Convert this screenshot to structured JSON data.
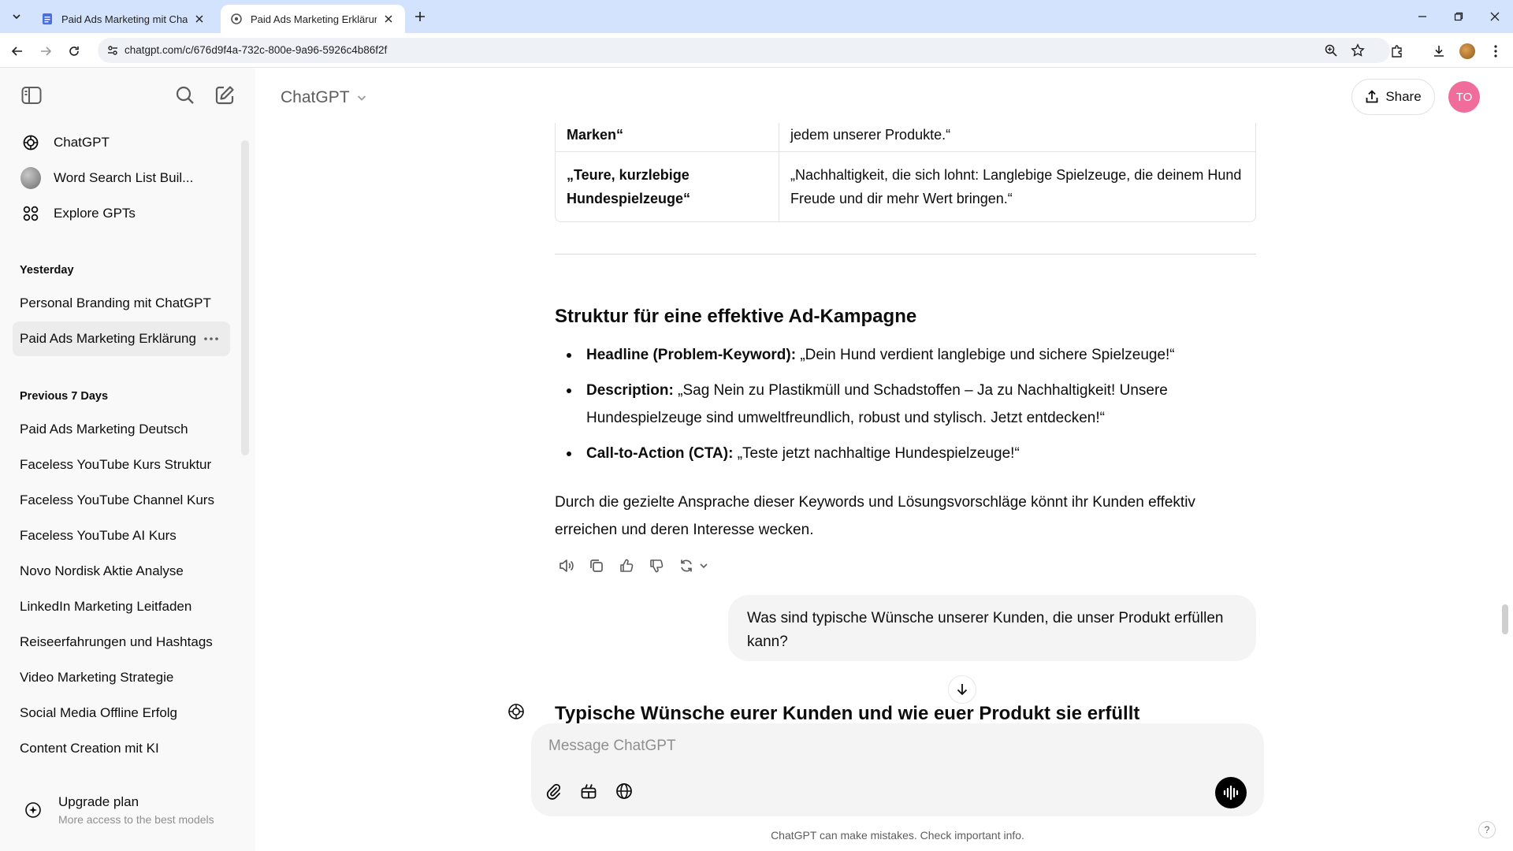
{
  "browser": {
    "tabs": [
      {
        "title": "Paid Ads Marketing mit ChatGPT",
        "active": false
      },
      {
        "title": "Paid Ads Marketing Erklärung",
        "active": true
      }
    ],
    "url": "chatgpt.com/c/676d9f4a-732c-800e-9a96-5926c4b86f2f"
  },
  "sidebar": {
    "nav": [
      {
        "label": "ChatGPT",
        "icon": "openai-logo-icon"
      },
      {
        "label": "Word Search List Buil...",
        "icon": "gpt-avatar"
      },
      {
        "label": "Explore GPTs",
        "icon": "grid-icon"
      }
    ],
    "sections": [
      {
        "title": "Yesterday",
        "items": [
          "Personal Branding mit ChatGPT",
          "Paid Ads Marketing Erklärung"
        ]
      },
      {
        "title": "Previous 7 Days",
        "items": [
          "Paid Ads Marketing Deutsch",
          "Faceless YouTube Kurs Struktur",
          "Faceless YouTube Channel Kurs",
          "Faceless YouTube AI Kurs",
          "Novo Nordisk Aktie Analyse",
          "LinkedIn Marketing Leitfaden",
          "Reiseerfahrungen und Hashtags",
          "Video Marketing Strategie",
          "Social Media Offline Erfolg",
          "Content Creation mit KI"
        ]
      }
    ],
    "upgrade": {
      "title": "Upgrade plan",
      "subtitle": "More access to the best models"
    }
  },
  "header": {
    "model": "ChatGPT",
    "share_label": "Share",
    "user_initials": "TO"
  },
  "table": {
    "rows": [
      {
        "problem": "Marken“",
        "solution": "jedem unserer Produkte.“"
      },
      {
        "problem": "„Teure, kurzlebige Hundespielzeuge“",
        "solution": "„Nachhaltigkeit, die sich lohnt: Langlebige Spielzeuge, die deinem Hund Freude und dir mehr Wert bringen.“"
      }
    ]
  },
  "answer": {
    "heading": "Struktur für eine effektive Ad-Kampagne",
    "bullets": [
      {
        "label": "Headline (Problem-Keyword):",
        "text": " „Dein Hund verdient langlebige und sichere Spielzeuge!“"
      },
      {
        "label": "Description:",
        "text": " „Sag Nein zu Plastikmüll und Schadstoffen – Ja zu Nachhaltigkeit! Unsere Hundespielzeuge sind umweltfreundlich, robust und stylisch. Jetzt entdecken!“"
      },
      {
        "label": "Call-to-Action (CTA):",
        "text": " „Teste jetzt nachhaltige Hundespielzeuge!“"
      }
    ],
    "paragraph": "Durch die gezielte Ansprache dieser Keywords und Lösungsvorschläge könnt ihr Kunden effektiv erreichen und deren Interesse wecken."
  },
  "user_message": "Was sind typische Wünsche unserer Kunden, die unser Produkt erfüllen kann?",
  "next_heading": "Typische Wünsche eurer Kunden und wie euer Produkt sie erfüllt",
  "composer": {
    "placeholder": "Message ChatGPT"
  },
  "disclaimer": "ChatGPT can make mistakes. Check important info.",
  "help_label": "?"
}
